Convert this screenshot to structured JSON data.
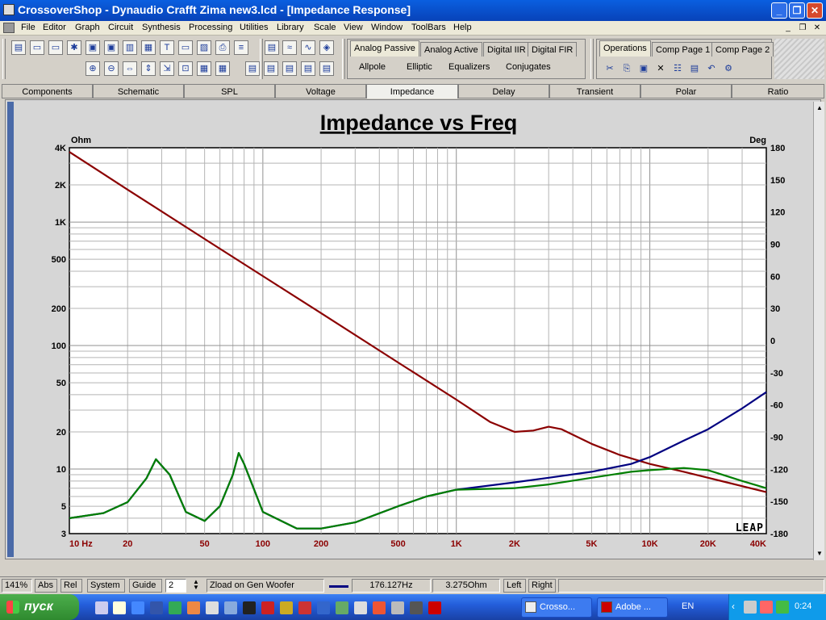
{
  "window": {
    "title": "CrossoverShop - Dynaudio Crafft Zima new3.lcd - [Impedance Response]",
    "controls": [
      "_",
      "❐",
      "✕"
    ]
  },
  "menu": [
    "File",
    "Editor",
    "Graph",
    "Circuit",
    "Synthesis",
    "Processing",
    "Utilities",
    "Library",
    "Scale",
    "View",
    "Window",
    "ToolBars",
    "Help"
  ],
  "toolbar": {
    "design_tabs": [
      "Analog Passive",
      "Analog Active",
      "Digital IIR",
      "Digital FIR"
    ],
    "design_subitems": [
      "Allpole",
      "Elliptic",
      "Equalizers",
      "Conjugates"
    ],
    "ops_tabs": [
      "Operations",
      "Comp Page 1",
      "Comp Page 2"
    ]
  },
  "view_tabs": [
    "Components",
    "Schematic",
    "SPL",
    "Voltage",
    "Impedance",
    "Delay",
    "Transient",
    "Polar",
    "Ratio"
  ],
  "active_view": "Impedance",
  "graph": {
    "title": "Impedance vs Freq",
    "left_unit": "Ohm",
    "right_unit": "Deg",
    "logo": "LEAP"
  },
  "chart_data": {
    "type": "line",
    "title": "Impedance vs Freq",
    "xlabel": "",
    "ylabel": "Ohm",
    "y2label": "Deg",
    "x_scale": "log",
    "y_scale": "log",
    "xlim": [
      10,
      40000
    ],
    "ylim": [
      3,
      4000
    ],
    "y2lim": [
      -180,
      180
    ],
    "x_ticks": [
      10,
      20,
      50,
      100,
      200,
      500,
      1000,
      2000,
      5000,
      10000,
      20000,
      40000
    ],
    "x_tick_labels": [
      "10  Hz",
      "20",
      "50",
      "100",
      "200",
      "500",
      "1K",
      "2K",
      "5K",
      "10K",
      "20K",
      "40K"
    ],
    "y_ticks": [
      3,
      5,
      10,
      20,
      50,
      100,
      200,
      500,
      1000,
      2000,
      4000
    ],
    "y_tick_labels": [
      "3",
      "5",
      "10",
      "20",
      "50",
      "100",
      "200",
      "500",
      "1K",
      "2K",
      "4K"
    ],
    "y2_ticks": [
      180,
      150,
      120,
      90,
      60,
      30,
      0,
      -30,
      -60,
      -90,
      -120,
      -150,
      -180
    ],
    "grid": true,
    "series": [
      {
        "color": "#8b0000",
        "axis": "left",
        "points": [
          [
            10,
            3700
          ],
          [
            20,
            1830
          ],
          [
            50,
            730
          ],
          [
            100,
            365
          ],
          [
            200,
            183
          ],
          [
            500,
            73
          ],
          [
            1000,
            36.5
          ],
          [
            1500,
            24
          ],
          [
            2000,
            20
          ],
          [
            2500,
            20.5
          ],
          [
            3000,
            22
          ],
          [
            3500,
            21
          ],
          [
            5000,
            16
          ],
          [
            7000,
            13
          ],
          [
            10000,
            11
          ],
          [
            15000,
            9.5
          ],
          [
            20000,
            8.5
          ],
          [
            40000,
            6.5
          ]
        ]
      },
      {
        "color": "#000080",
        "axis": "left",
        "points": [
          [
            10,
            4
          ],
          [
            15,
            4.4
          ],
          [
            20,
            5.4
          ],
          [
            25,
            8.4
          ],
          [
            28,
            12
          ],
          [
            33,
            9
          ],
          [
            40,
            4.5
          ],
          [
            50,
            3.8
          ],
          [
            60,
            5
          ],
          [
            70,
            9
          ],
          [
            75,
            13.5
          ],
          [
            80,
            11
          ],
          [
            100,
            4.5
          ],
          [
            150,
            3.3
          ],
          [
            200,
            3.3
          ],
          [
            300,
            3.7
          ],
          [
            500,
            5
          ],
          [
            700,
            6
          ],
          [
            1000,
            6.8
          ],
          [
            2000,
            7.8
          ],
          [
            3000,
            8.5
          ],
          [
            5000,
            9.5
          ],
          [
            8000,
            11
          ],
          [
            10000,
            12.5
          ],
          [
            15000,
            17
          ],
          [
            20000,
            21
          ],
          [
            30000,
            31
          ],
          [
            40000,
            42
          ]
        ]
      },
      {
        "color": "#007f00",
        "axis": "left",
        "points": [
          [
            10,
            4
          ],
          [
            15,
            4.4
          ],
          [
            20,
            5.4
          ],
          [
            25,
            8.4
          ],
          [
            28,
            12
          ],
          [
            33,
            9
          ],
          [
            40,
            4.5
          ],
          [
            50,
            3.8
          ],
          [
            60,
            5
          ],
          [
            70,
            9
          ],
          [
            75,
            13.5
          ],
          [
            80,
            11
          ],
          [
            100,
            4.5
          ],
          [
            150,
            3.3
          ],
          [
            200,
            3.3
          ],
          [
            300,
            3.7
          ],
          [
            500,
            5
          ],
          [
            700,
            6
          ],
          [
            1000,
            6.8
          ],
          [
            2000,
            7
          ],
          [
            3000,
            7.5
          ],
          [
            5000,
            8.5
          ],
          [
            8000,
            9.5
          ],
          [
            10000,
            9.8
          ],
          [
            15000,
            10.2
          ],
          [
            20000,
            9.8
          ],
          [
            30000,
            8
          ],
          [
            40000,
            7
          ]
        ]
      }
    ]
  },
  "status": {
    "zoom": "141%",
    "abs": "Abs",
    "rel": "Rel",
    "system": "System",
    "guide": "Guide",
    "guide_value": "2",
    "series_label": "Zload on Gen Woofer",
    "freq": "176.127Hz",
    "value": "3.275Ohm",
    "left": "Left",
    "right": "Right"
  },
  "taskbar": {
    "start": "пуск",
    "tasks": [
      "Crosso...",
      "Adobe ..."
    ],
    "lang": "EN",
    "clock": "0:24"
  },
  "colors": {
    "accent": "#0842b8",
    "plot_bg": "#ffffff",
    "grid": "#b4b4b4"
  }
}
